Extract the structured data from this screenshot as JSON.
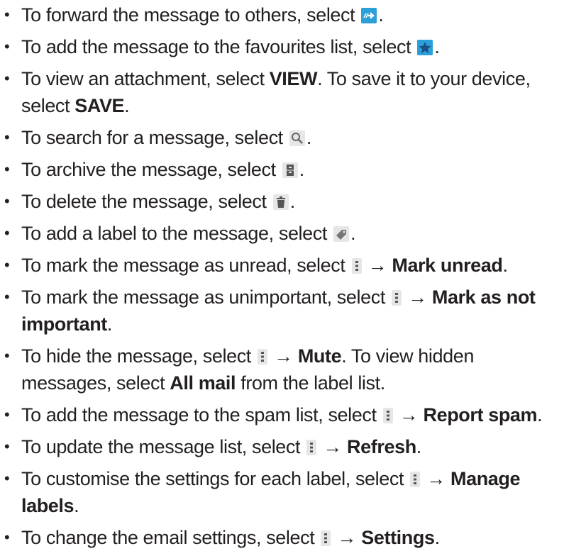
{
  "items": [
    {
      "p1": "To forward the message to others, select ",
      "icon": "forward-icon",
      "p2": "."
    },
    {
      "p1": "To add the message to the favourites list, select ",
      "icon": "star-icon",
      "p2": "."
    },
    {
      "p1": "To view an attachment, select ",
      "b1": "VIEW",
      "p2": ". To save it to your device, select ",
      "b2": "SAVE",
      "p3": "."
    },
    {
      "p1": "To search for a message, select ",
      "icon": "search-icon",
      "p2": "."
    },
    {
      "p1": "To archive the message, select ",
      "icon": "archive-icon",
      "p2": "."
    },
    {
      "p1": "To delete the message, select ",
      "icon": "delete-icon",
      "p2": "."
    },
    {
      "p1": "To add a label to the message, select ",
      "icon": "label-icon",
      "p2": "."
    },
    {
      "p1": "To mark the message as unread, select ",
      "icon": "menu-icon",
      "arrow": " → ",
      "b1": "Mark unread",
      "p2": "."
    },
    {
      "p1": "To mark the message as unimportant, select ",
      "icon": "menu-icon",
      "arrow": " → ",
      "b1": "Mark as not important",
      "p2": "."
    },
    {
      "p1": "To hide the message, select ",
      "icon": "menu-icon",
      "arrow": " → ",
      "b1": "Mute",
      "p2": ". To view hidden messages, select ",
      "b2": "All mail",
      "p3": " from the label list."
    },
    {
      "p1": "To add the message to the spam list, select ",
      "icon": "menu-icon",
      "arrow": " → ",
      "b1": "Report spam",
      "p2": "."
    },
    {
      "p1": "To update the message list, select ",
      "icon": "menu-icon",
      "arrow": " → ",
      "b1": "Refresh",
      "p2": "."
    },
    {
      "p1": "To customise the settings for each label, select ",
      "icon": "menu-icon",
      "arrow": " → ",
      "b1": "Manage labels",
      "p2": "."
    },
    {
      "p1": "To change the email settings, select ",
      "icon": "menu-icon",
      "arrow": " → ",
      "b1": "Settings",
      "p2": "."
    }
  ],
  "bullet": "•",
  "colors": {
    "accent_blue": "#2b9fd8",
    "icon_grey_bg": "#e6e6e6",
    "text": "#231f20"
  }
}
